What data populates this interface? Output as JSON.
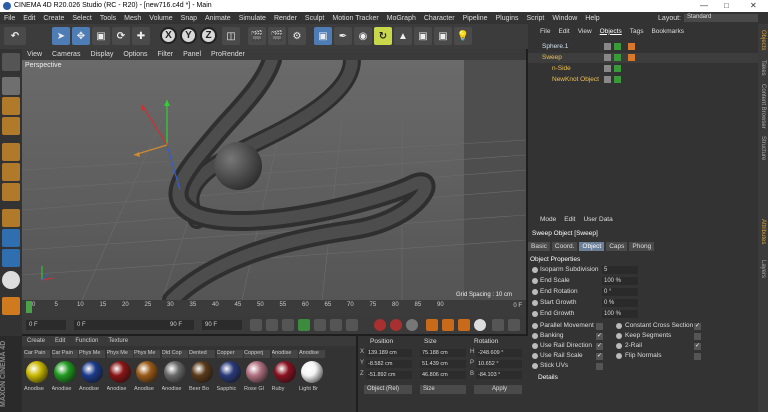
{
  "window": {
    "title": "CINEMA 4D R20.026 Studio (RC - R20) - [new716.c4d *] - Main"
  },
  "menu": [
    "File",
    "Edit",
    "Create",
    "Select",
    "Tools",
    "Mesh",
    "Volume",
    "Snap",
    "Animate",
    "Simulate",
    "Render",
    "Sculpt",
    "Motion Tracker",
    "MoGraph",
    "Character",
    "Pipeline",
    "Plugins",
    "Script",
    "Window",
    "Help"
  ],
  "layout": {
    "label": "Layout:",
    "value": "Standard"
  },
  "toolbar": {
    "x": "X",
    "y": "Y",
    "z": "Z"
  },
  "viewport": {
    "menu": [
      "View",
      "Cameras",
      "Display",
      "Options",
      "Filter",
      "Panel",
      "ProRender"
    ],
    "label": "Perspective",
    "grid_spacing": "Grid Spacing : 10 cm"
  },
  "timeline": {
    "ticks": [
      "0",
      "5",
      "10",
      "15",
      "20",
      "25",
      "30",
      "35",
      "40",
      "45",
      "50",
      "55",
      "60",
      "65",
      "70",
      "75",
      "80",
      "85",
      "90"
    ],
    "end_label": "0 F"
  },
  "transport": {
    "current": "0 F",
    "start": "0 F",
    "end": "90 F",
    "max": "90 F"
  },
  "materials": {
    "tabs": [
      "Create",
      "Edit",
      "Function",
      "Texture"
    ],
    "items": [
      {
        "name": "Car Pain",
        "label": "Anodise",
        "color": "#c9b800"
      },
      {
        "name": "Car Pain",
        "label": "Anodise",
        "color": "#1f9a1f"
      },
      {
        "name": "Phys Me",
        "label": "Anodise",
        "color": "#1b3a8a"
      },
      {
        "name": "Phys Me",
        "label": "Anodise",
        "color": "#8a1414"
      },
      {
        "name": "Phys Me",
        "label": "Anodise",
        "color": "#9a5a18"
      },
      {
        "name": "Old Cop",
        "label": "Anodise",
        "color": "#6a6a6a"
      },
      {
        "name": "Dented",
        "label": "Beer Bo",
        "color": "#5a3a1a"
      },
      {
        "name": "Copper",
        "label": "Sapphic",
        "color": "#2a3a7a"
      },
      {
        "name": "Copperj",
        "label": "Rose Gl",
        "color": "#b07080"
      },
      {
        "name": "Anodise",
        "label": "Ruby",
        "color": "#8a1020"
      },
      {
        "name": "Anodise",
        "label": "Light Br",
        "color": "#f4f4f4"
      }
    ]
  },
  "coordinates": {
    "headers": [
      "Position",
      "Size",
      "Rotation"
    ],
    "rows": [
      {
        "axis": "X",
        "pos": "139.189 cm",
        "size": "75.188 cm",
        "rot_axis": "H",
        "rot": "-248.609 °"
      },
      {
        "axis": "Y",
        "pos": "-8.582 cm",
        "size": "51.439 cm",
        "rot_axis": "P",
        "rot": "10.652 °"
      },
      {
        "axis": "Z",
        "pos": "-51.892 cm",
        "size": "46.806 cm",
        "rot_axis": "B",
        "rot": "-84.103 °"
      }
    ],
    "mode": "Object (Rel)",
    "size_mode": "Size",
    "apply": "Apply"
  },
  "objects": {
    "menu": [
      "File",
      "Edit",
      "View",
      "Objects",
      "Tags",
      "Bookmarks"
    ],
    "items": [
      {
        "name": "Sphere.1",
        "indent": 0,
        "color": "#cfe0f0"
      },
      {
        "name": "Sweep",
        "indent": 0,
        "color": "#f0c050"
      },
      {
        "name": "n-Side",
        "indent": 1,
        "color": "#f0c050"
      },
      {
        "name": "NewKnot Object",
        "indent": 1,
        "color": "#f0c050"
      }
    ]
  },
  "attributes": {
    "menu": [
      "Mode",
      "Edit",
      "User Data"
    ],
    "title": "Sweep Object [Sweep]",
    "tabs": [
      "Basic",
      "Coord.",
      "Object",
      "Caps",
      "Phong"
    ],
    "active_tab": "Object",
    "section": "Object Properties",
    "fields": [
      {
        "label": "Isoparm Subdivision",
        "value": "5"
      },
      {
        "label": "End Scale",
        "value": "100 %"
      },
      {
        "label": "End Rotation",
        "value": "0 °"
      },
      {
        "label": "Start Growth",
        "value": "0 %"
      },
      {
        "label": "End Growth",
        "value": "100 %"
      }
    ],
    "checks_left": [
      {
        "label": "Parallel Movement",
        "checked": false
      },
      {
        "label": "Banking",
        "checked": true
      },
      {
        "label": "Use Rail Direction",
        "checked": true
      },
      {
        "label": "Use Rail Scale",
        "checked": true
      },
      {
        "label": "Stick UVs",
        "checked": false
      }
    ],
    "checks_right": [
      {
        "label": "Constant Cross Section",
        "checked": true
      },
      {
        "label": "Keep Segments",
        "checked": false
      },
      {
        "label": "2-Rail",
        "checked": true
      },
      {
        "label": "Flip Normals",
        "checked": false
      }
    ],
    "details": "Details"
  },
  "side_tabs": [
    "Objects",
    "Takes",
    "Content Browser",
    "Structure",
    "Attributes",
    "Layers"
  ],
  "brand": "MAXON CINEMA 4D"
}
